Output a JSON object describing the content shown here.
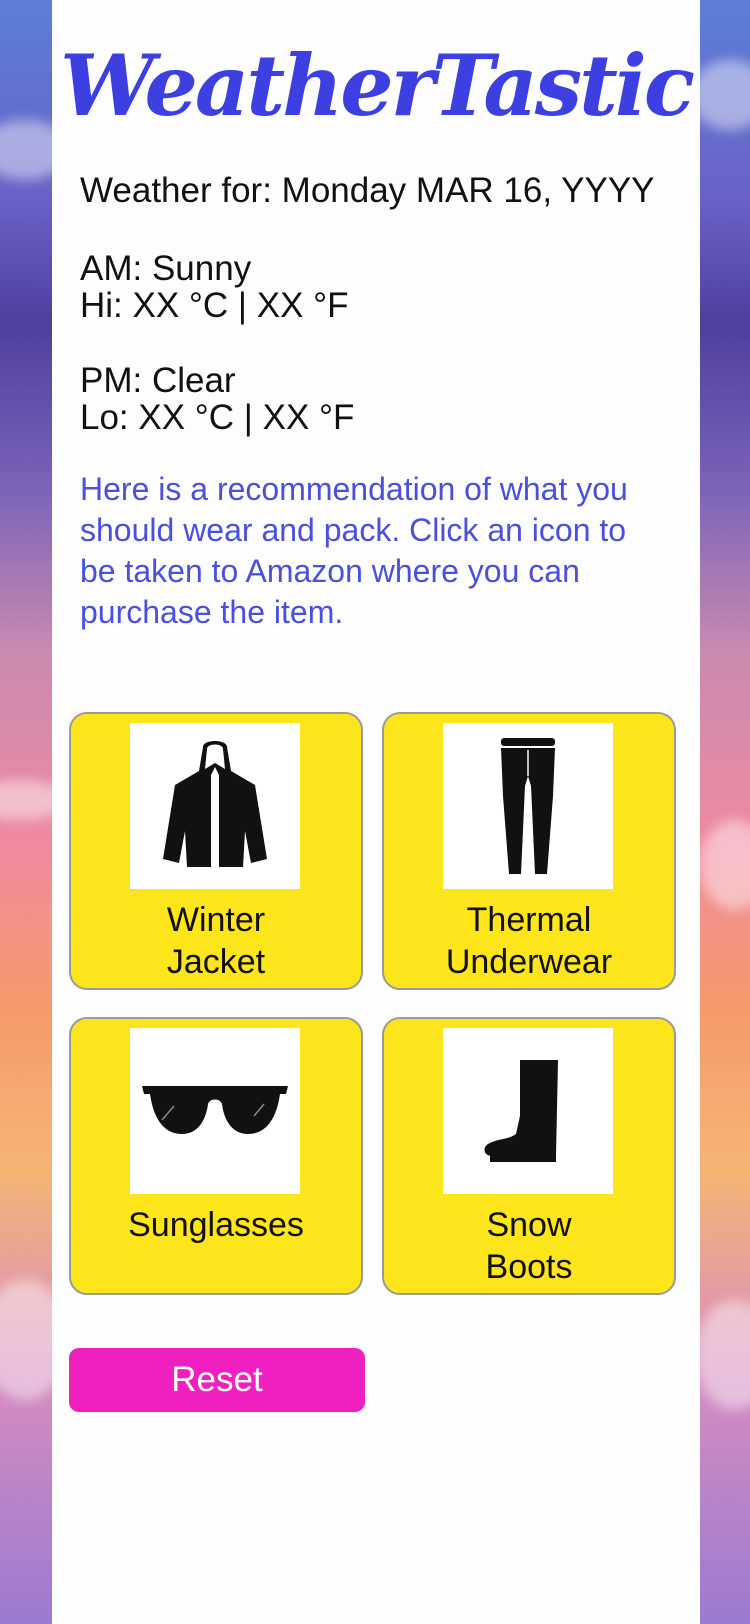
{
  "app": {
    "logo": "WeatherTastic"
  },
  "weather": {
    "date_line": "Weather for: Monday MAR 16, YYYY",
    "am_line": "AM: Sunny",
    "hi_line": "Hi: XX °C | XX °F",
    "pm_line": "PM: Clear",
    "lo_line": "Lo: XX °C | XX °F"
  },
  "recommendation": {
    "text": "Here is a recommendation of what you should wear and pack. Click an icon to be taken to Amazon where you can purchase the item."
  },
  "items": [
    {
      "label_1": "Winter",
      "label_2": "Jacket",
      "icon": "jacket-icon"
    },
    {
      "label_1": "Thermal",
      "label_2": "Underwear",
      "icon": "leggings-icon"
    },
    {
      "label_1": "Sunglasses",
      "label_2": "",
      "icon": "sunglasses-icon"
    },
    {
      "label_1": "Snow",
      "label_2": "Boots",
      "icon": "boot-icon"
    }
  ],
  "actions": {
    "reset_label": "Reset"
  },
  "colors": {
    "brand": "#3d3fe0",
    "card": "#fde51b",
    "reset": "#f020c0",
    "recommend_text": "#4a4fe0"
  }
}
